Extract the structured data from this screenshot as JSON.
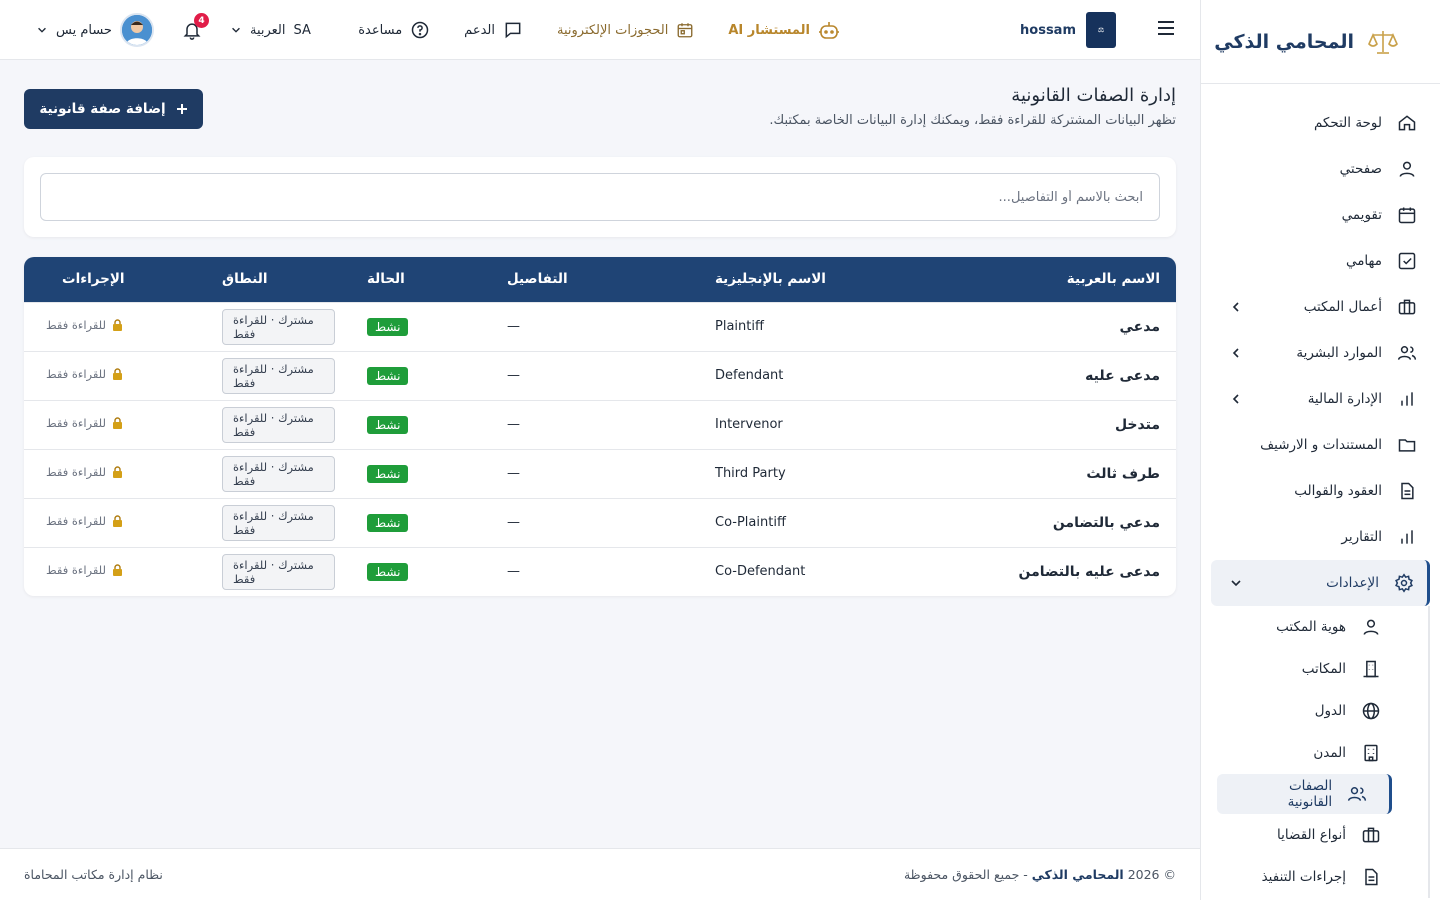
{
  "brand": {
    "name": "المحامي الذكي"
  },
  "sidebar": {
    "items": [
      {
        "label": "لوحة التحكم",
        "icon": "home-icon"
      },
      {
        "label": "صفحتي",
        "icon": "user-icon"
      },
      {
        "label": "تقويمي",
        "icon": "calendar-icon"
      },
      {
        "label": "مهامي",
        "icon": "check-square-icon"
      },
      {
        "label": "أعمال المكتب",
        "icon": "briefcase-icon"
      },
      {
        "label": "الموارد البشرية",
        "icon": "users-icon"
      },
      {
        "label": "الإدارة المالية",
        "icon": "bar-chart-icon"
      },
      {
        "label": "المستندات و الارشيف",
        "icon": "folder-icon"
      },
      {
        "label": "العقود والقوالب",
        "icon": "file-icon"
      },
      {
        "label": "التقارير",
        "icon": "bar-chart-icon"
      },
      {
        "label": "الإعدادات",
        "icon": "gear-icon"
      }
    ],
    "settings_sub": [
      {
        "label": "هوية المكتب",
        "icon": "user-icon"
      },
      {
        "label": "المكاتب",
        "icon": "building-icon"
      },
      {
        "label": "الدول",
        "icon": "globe-icon"
      },
      {
        "label": "المدن",
        "icon": "city-icon"
      },
      {
        "label": "الصفات القانونية",
        "icon": "users-icon"
      },
      {
        "label": "أنواع القضايا",
        "icon": "briefcase-icon"
      },
      {
        "label": "إجراءات التنفيذ",
        "icon": "file-icon"
      }
    ]
  },
  "topbar": {
    "office_user": "hossam",
    "ai_label": "المستشار AI",
    "bookings_label": "الحجوزات الإلكترونية",
    "support_label": "الدعم",
    "help_label": "مساعدة",
    "language_label": "العربية",
    "language_code": "SA",
    "notifications_count": "4",
    "user_name": "حسام يس"
  },
  "page": {
    "title": "إدارة الصفات القانونية",
    "subtitle": "تظهر البيانات المشتركة للقراءة فقط، ويمكنك إدارة البيانات الخاصة بمكتبك.",
    "add_button": "إضافة صفة قانونية"
  },
  "search": {
    "placeholder": "ابحث بالاسم أو التفاصيل..."
  },
  "table": {
    "headers": {
      "ar_name": "الاسم بالعربية",
      "en_name": "الاسم بالإنجليزية",
      "details": "التفاصيل",
      "status": "الحالة",
      "scope": "النطاق",
      "actions": "الإجراءات"
    },
    "rows": [
      {
        "ar": "مدعي",
        "en": "Plaintiff",
        "details": "—",
        "status": "نشط",
        "scope": "مشترك · للقراءة فقط",
        "action": "للقراءة فقط"
      },
      {
        "ar": "مدعى عليه",
        "en": "Defendant",
        "details": "—",
        "status": "نشط",
        "scope": "مشترك · للقراءة فقط",
        "action": "للقراءة فقط"
      },
      {
        "ar": "متدخل",
        "en": "Intervenor",
        "details": "—",
        "status": "نشط",
        "scope": "مشترك · للقراءة فقط",
        "action": "للقراءة فقط"
      },
      {
        "ar": "طرف ثالث",
        "en": "Third Party",
        "details": "—",
        "status": "نشط",
        "scope": "مشترك · للقراءة فقط",
        "action": "للقراءة فقط"
      },
      {
        "ar": "مدعي بالتضامن",
        "en": "Co-Plaintiff",
        "details": "—",
        "status": "نشط",
        "scope": "مشترك · للقراءة فقط",
        "action": "للقراءة فقط"
      },
      {
        "ar": "مدعى عليه بالتضامن",
        "en": "Co-Defendant",
        "details": "—",
        "status": "نشط",
        "scope": "مشترك · للقراءة فقط",
        "action": "للقراءة فقط"
      }
    ]
  },
  "footer": {
    "copyright_prefix": "© 2026",
    "copyright_brand": "المحامي الذكي",
    "copyright_suffix": "- جميع الحقوق محفوظة",
    "system_name": "نظام إدارة مكاتب المحاماة"
  },
  "colors": {
    "primary": "#1f3b63",
    "header": "#1f4475",
    "success": "#1f9d3a",
    "accent": "#b8862b"
  }
}
